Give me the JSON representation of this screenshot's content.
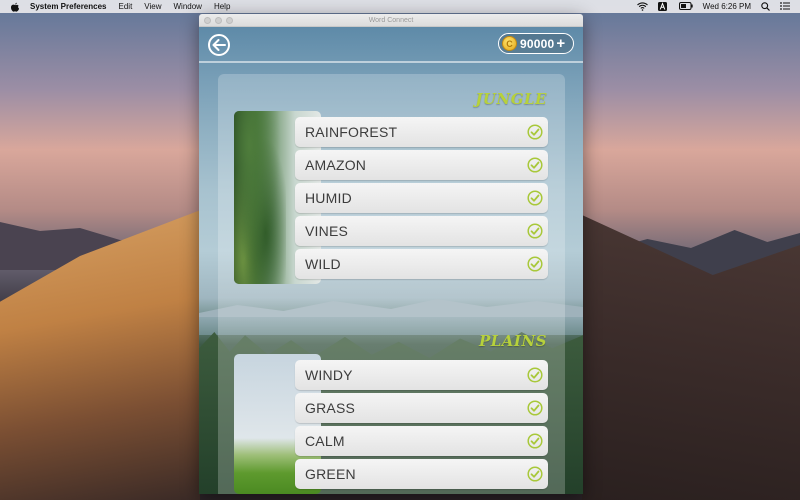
{
  "menubar": {
    "app_name": "System Preferences",
    "menus": [
      "Edit",
      "View",
      "Window",
      "Help"
    ],
    "clock": "Wed 6:26 PM"
  },
  "window": {
    "title": "Word Connect"
  },
  "header": {
    "coins": "90000",
    "coin_glyph": "C",
    "add_glyph": "+"
  },
  "categories": [
    {
      "title": "JUNGLE",
      "words": [
        "RAINFOREST",
        "AMAZON",
        "HUMID",
        "VINES",
        "WILD"
      ]
    },
    {
      "title": "PLAINS",
      "words": [
        "WINDY",
        "GRASS",
        "CALM",
        "GREEN"
      ]
    }
  ],
  "colors": {
    "category_title": "#b7d13b",
    "check": "#a8c83a"
  }
}
